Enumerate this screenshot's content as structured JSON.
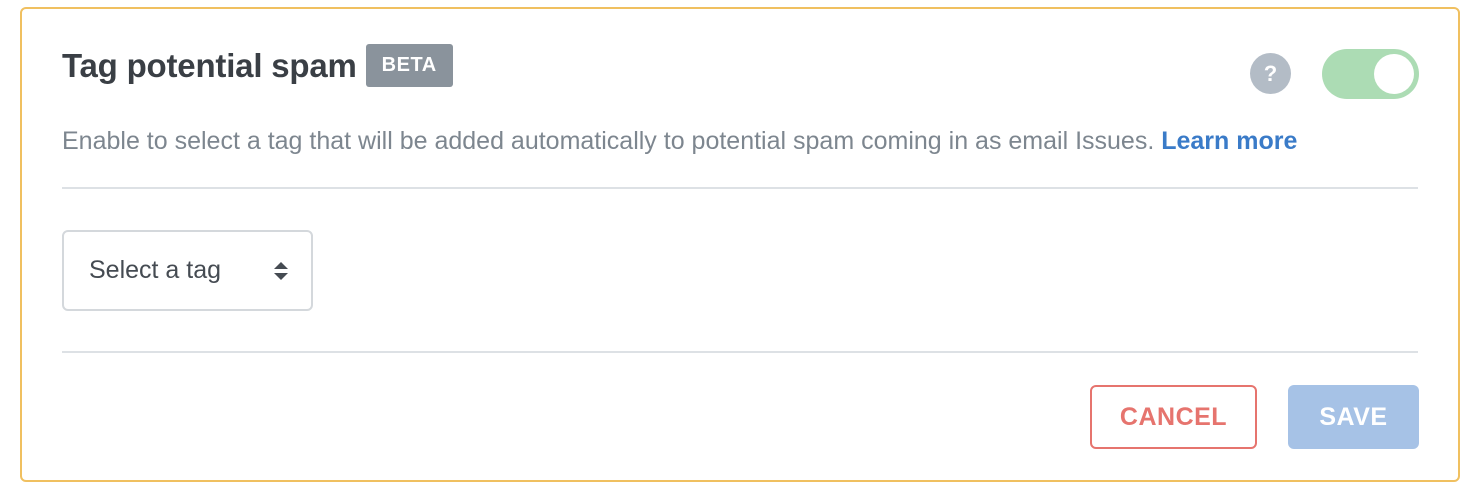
{
  "header": {
    "title": "Tag potential spam",
    "badge": "BETA",
    "help_glyph": "?",
    "help_icon": "question-circle-icon",
    "toggle_state": "on"
  },
  "description": {
    "text": "Enable to select a tag that will be added automatically to potential spam coming in as email Issues.",
    "link_label": "Learn more"
  },
  "tag_select": {
    "selected_value": "Select a tag",
    "icon": "sort-arrows-icon"
  },
  "actions": {
    "cancel_label": "CANCEL",
    "save_label": "SAVE"
  },
  "colors": {
    "card_border": "#f0c060",
    "toggle_on": "#acdcb4",
    "link": "#3a7bc8",
    "cancel": "#e6746e",
    "save_disabled": "#a6c2e6",
    "badge": "#8a939c"
  }
}
